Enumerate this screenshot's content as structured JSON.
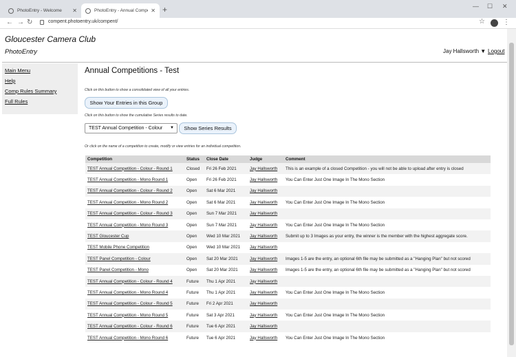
{
  "browser": {
    "tabs": [
      {
        "label": "PhotoEntry - Welcome"
      },
      {
        "label": "PhotoEntry - Annual Competitio..."
      }
    ],
    "url": "compent.photoentry.uk/compent/"
  },
  "site": {
    "title": "Gloucester Camera Club",
    "subtitle": "PhotoEntry",
    "user": "Jay Hallsworth ▼",
    "logout": "Logout"
  },
  "sidebar": {
    "items": [
      {
        "label": "Main Menu"
      },
      {
        "label": "Help"
      },
      {
        "label": "Comp Rules Summary"
      },
      {
        "label": "Full Rules"
      }
    ]
  },
  "main": {
    "heading": "Annual Competitions - Test",
    "hint_entries": "Click on this button to show a consolidated view of all your entries.",
    "entries_button": "Show Your Entries in this Group",
    "hint_series": "Click on this button to show the cumulative Series results to date.",
    "series_select": "TEST Annual Competition - Colour",
    "series_button": "Show Series Results",
    "hint_competition": "Or click on the name of a competition to create, modify or view entries for an individual competition."
  },
  "table": {
    "headers": [
      "Competition",
      "Status",
      "Close Date",
      "Judge",
      "Comment"
    ],
    "rows": [
      [
        "TEST Annual Competition - Colour - Round 1",
        "Closed",
        "Fri 26 Feb 2021",
        "Jay Hallsworth",
        "This is an example of a closed Competition - you will not be able to upload after entry is closed"
      ],
      [
        "TEST Annual Competition - Mono Round 1",
        "Open",
        "Fri 26 Feb 2021",
        "Jay Hallsworth",
        "You Can Enter Just One Image In The Mono Section"
      ],
      [
        "TEST Annual Competition - Colour - Round 2",
        "Open",
        "Sat 6 Mar 2021",
        "Jay Hallsworth",
        ""
      ],
      [
        "TEST Annual Competition - Mono Round 2",
        "Open",
        "Sat 6 Mar 2021",
        "Jay Hallsworth",
        "You Can Enter Just One Image In The Mono Section"
      ],
      [
        "TEST Annual Competition - Colour - Round 3",
        "Open",
        "Sun 7 Mar 2021",
        "Jay Hallsworth",
        ""
      ],
      [
        "TEST Annual Competition - Mono Round 3",
        "Open",
        "Sun 7 Mar 2021",
        "Jay Hallsworth",
        "You Can Enter Just One Image In The Mono Section"
      ],
      [
        "TEST Gloucester Cup",
        "Open",
        "Wed 10 Mar 2021",
        "Jay Hallsworth",
        "Submit up to 3 Images as your entry, the winner is the member with the highest aggregate score."
      ],
      [
        "TEST Mobile Phone Competition",
        "Open",
        "Wed 10 Mar 2021",
        "Jay Hallsworth",
        ""
      ],
      [
        "TEST Panel Competition - Colour",
        "Open",
        "Sat 20 Mar 2021",
        "Jay Hallsworth",
        "Images 1-5 are the entry, an optional 6th file may be submitted as a \"Hanging Plan\" but not scored"
      ],
      [
        "TEST Panel Competition - Mono",
        "Open",
        "Sat 20 Mar 2021",
        "Jay Hallsworth",
        "Images 1-5 are the entry, an optional 6th file may be submitted as a \"Hanging Plan\" but not scored"
      ],
      [
        "TEST Annual Competition - Colour - Round 4",
        "Future",
        "Thu 1 Apr 2021",
        "Jay Hallsworth",
        ""
      ],
      [
        "TEST Annual Competition - Mono Round 4",
        "Future",
        "Thu 1 Apr 2021",
        "Jay Hallsworth",
        "You Can Enter Just One Image In The Mono Section"
      ],
      [
        "TEST Annual Competition - Colour - Round 5",
        "Future",
        "Fri 2 Apr 2021",
        "Jay Hallsworth",
        ""
      ],
      [
        "TEST Annual Competition - Mono Round 5",
        "Future",
        "Sat 3 Apr 2021",
        "Jay Hallsworth",
        "You Can Enter Just One Image In The Mono Section"
      ],
      [
        "TEST Annual Competition - Colour - Round 6",
        "Future",
        "Tue 6 Apr 2021",
        "Jay Hallsworth",
        ""
      ],
      [
        "TEST Annual Competition - Mono Round 6",
        "Future",
        "Tue 6 Apr 2021",
        "Jay Hallsworth",
        "You Can Enter Just One Image In The Mono Section"
      ]
    ]
  }
}
